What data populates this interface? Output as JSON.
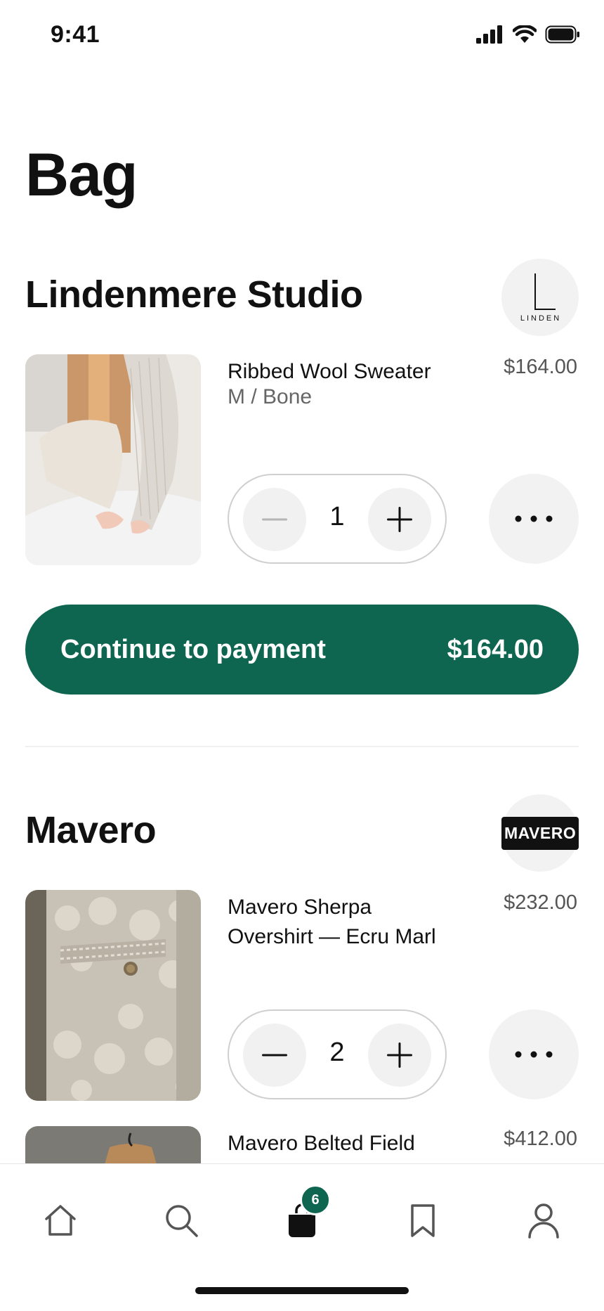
{
  "status_bar": {
    "time": "9:41"
  },
  "page": {
    "title": "Bag"
  },
  "tabbar": {
    "bag_badge": "6"
  },
  "stores": [
    {
      "name": "Lindenmere Studio",
      "logo_text": "L",
      "logo_subtext": "LINDEN",
      "items": [
        {
          "name": "Ribbed Wool Sweater",
          "variant": "M / Bone",
          "price": "$164.00",
          "quantity": "1"
        }
      ],
      "checkout": {
        "label": "Continue to payment",
        "total": "$164.00"
      }
    },
    {
      "name": "Mavero",
      "logo_text": "MAVERO",
      "items": [
        {
          "name": "Mavero Sherpa Overshirt — Ecru Marl",
          "price": "$232.00",
          "quantity": "2"
        },
        {
          "name": "Mavero Belted Field",
          "price": "$412.00"
        }
      ]
    }
  ],
  "colors": {
    "accent": "#0f6650",
    "text": "#111111",
    "muted": "#666666"
  }
}
